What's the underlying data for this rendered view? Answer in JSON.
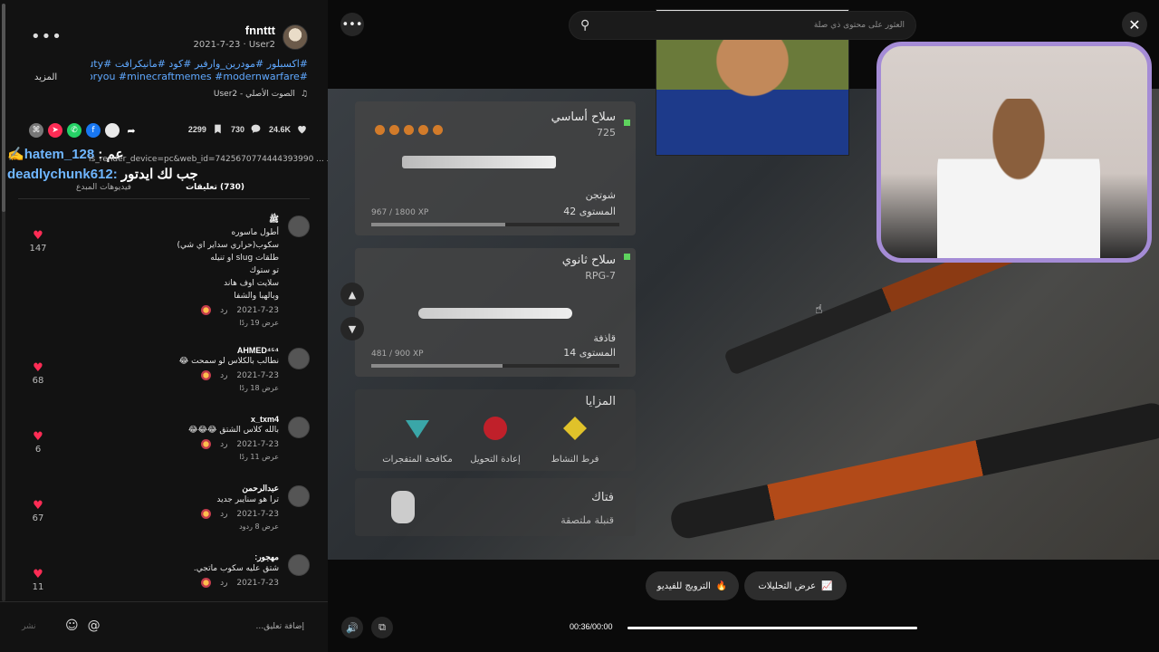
{
  "post": {
    "author": "fnnttt",
    "date_line": "2021-7-23 · User2",
    "more_menu": "•••",
    "caption_line1": "#اكسبلور #مودرين_وارفير #كود #مانيكرافت #callofduty",
    "caption_line2": "#foryou #minecraftmemes #modernwarfare...",
    "more_label": "المزيد",
    "sound": "الصوت الأصلي - User2",
    "likes": "24.6K",
    "comments": "730",
    "saves": "2299"
  },
  "overlay": {
    "line1_user": "hatem_128",
    "line1_sep": ": عم",
    "link_text": "is_render_device=pc&web_id=7425670774444393990 ... نسخ الرابط",
    "line2_user": "deadlychunk612",
    "line2_text": "جب لك ايدتور"
  },
  "tabs": {
    "comments": "(730) تعليقات",
    "creator": "فيديوهات المبدع"
  },
  "comments": [
    {
      "name": "ﷺ",
      "text": "أطول ماسوره\nسكوب(حراري سداير اي شي)\nطلقات slug او تنيله\nتو ستوك\nسلايت اوف هاند\nوبالهبا والشفا",
      "date": "2021-7-23",
      "reply": "رد",
      "replies": "عرض 19 ردًا",
      "likes": "147"
    },
    {
      "name": "AHMED⁴⁵⁴",
      "text": "نطالب بالكلاس لو سمحت 😂",
      "date": "2021-7-23",
      "reply": "رد",
      "replies": "عرض 18 ردًا",
      "likes": "68"
    },
    {
      "name": "x_txm4",
      "text": "بالله كلاس الشتق 😂😂😂",
      "date": "2021-7-23",
      "reply": "رد",
      "replies": "عرض 11 ردًا",
      "likes": "6"
    },
    {
      "name": "عبدالرحمن",
      "text": "ترا هو سنايبر جديد",
      "date": "2021-7-23",
      "reply": "رد",
      "replies": "عرض 8 ردود",
      "likes": "67"
    },
    {
      "name": "مهجور:",
      "text": "شتق عليه سكوب ماتجي.",
      "date": "2021-7-23",
      "reply": "رد",
      "replies": "",
      "likes": "11"
    }
  ],
  "composer": {
    "placeholder": "إضافة تعليق...",
    "post": "نشر"
  },
  "search": {
    "placeholder": "العثور على محتوى ذي صلة"
  },
  "game": {
    "primary_title": "سلاح أساسي",
    "primary_code": "725",
    "primary_type": "شوتجن",
    "primary_level": "المستوى 42",
    "primary_xp": "967 / 1800 XP",
    "primary_xp_fraction": 0.54,
    "secondary_title": "سلاح ثانوي",
    "secondary_code": "RPG-7",
    "secondary_type": "قاذفة",
    "secondary_level": "المستوى 14",
    "secondary_xp": "481 / 900 XP",
    "secondary_xp_fraction": 0.53,
    "perks_title": "المزايا",
    "perk1": "فرط النشاط",
    "perk2": "إعادة التحويل",
    "perk3": "مكافحة المتفجرات",
    "lethal_title": "فتاك",
    "lethal_item": "قنبلة ملتصقة"
  },
  "controls": {
    "promote": "الترويج للفيديو",
    "analytics": "عرض التحليلات",
    "time": "00:36/00:00",
    "progress_fraction": 1.0
  }
}
